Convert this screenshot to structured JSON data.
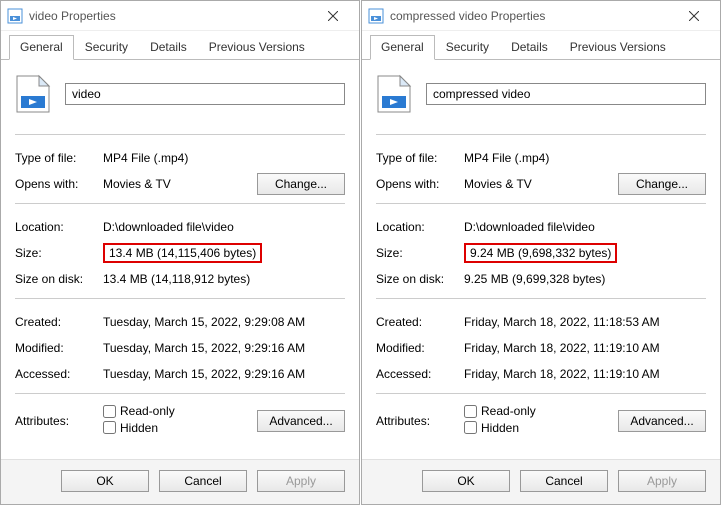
{
  "dialogs": [
    {
      "title": "video Properties",
      "tabs": [
        "General",
        "Security",
        "Details",
        "Previous Versions"
      ],
      "filename": "video",
      "file_type": "MP4 File (.mp4)",
      "opens_with": "Movies & TV",
      "location": "D:\\downloaded file\\video",
      "size": "13.4 MB (14,115,406 bytes)",
      "size_on_disk": "13.4 MB (14,118,912 bytes)",
      "created": "Tuesday, March 15, 2022, 9:29:08 AM",
      "modified": "Tuesday, March 15, 2022, 9:29:16 AM",
      "accessed": "Tuesday, March 15, 2022, 9:29:16 AM"
    },
    {
      "title": "compressed video Properties",
      "tabs": [
        "General",
        "Security",
        "Details",
        "Previous Versions"
      ],
      "filename": "compressed video",
      "file_type": "MP4 File (.mp4)",
      "opens_with": "Movies & TV",
      "location": "D:\\downloaded file\\video",
      "size": "9.24 MB (9,698,332 bytes)",
      "size_on_disk": "9.25 MB (9,699,328 bytes)",
      "created": "Friday, March 18, 2022, 11:18:53 AM",
      "modified": "Friday, March 18, 2022, 11:19:10 AM",
      "accessed": "Friday, March 18, 2022, 11:19:10 AM"
    }
  ],
  "labels": {
    "type_of_file": "Type of file:",
    "opens_with": "Opens with:",
    "change": "Change...",
    "location": "Location:",
    "size": "Size:",
    "size_on_disk": "Size on disk:",
    "created": "Created:",
    "modified": "Modified:",
    "accessed": "Accessed:",
    "attributes": "Attributes:",
    "read_only": "Read-only",
    "hidden": "Hidden",
    "advanced": "Advanced...",
    "ok": "OK",
    "cancel": "Cancel",
    "apply": "Apply"
  }
}
